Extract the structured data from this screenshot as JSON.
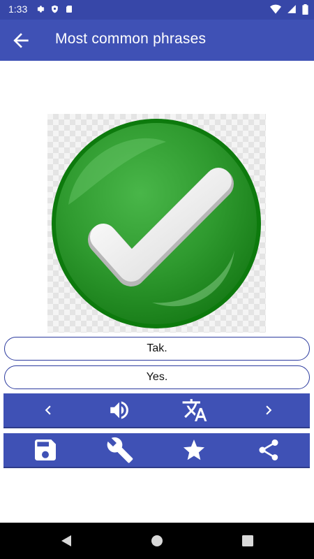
{
  "status_bar": {
    "time": "1:33",
    "left_icons": [
      "gear-icon",
      "shield-icon",
      "sd-card-icon"
    ],
    "right_icons": [
      "wifi-icon",
      "signal-icon",
      "battery-icon"
    ]
  },
  "app_bar": {
    "title": "Most common phrases",
    "back_icon": "arrow-back-icon"
  },
  "picture": {
    "description_icon": "green-checkmark-icon"
  },
  "phrases": {
    "foreign": "Tak.",
    "native": "Yes."
  },
  "controls_row": {
    "items": [
      "chevron-left-icon",
      "speaker-icon",
      "translate-icon",
      "chevron-right-icon"
    ]
  },
  "actions_row": {
    "items": [
      "save-icon",
      "wrench-icon",
      "star-icon",
      "share-icon"
    ]
  },
  "colors": {
    "primary": "#3f51b5",
    "status_bar": "#3747a8",
    "check_green": "#2e9a2e"
  },
  "nav_bar": {
    "items": [
      "nav-back-icon",
      "nav-home-icon",
      "nav-recents-icon"
    ]
  }
}
